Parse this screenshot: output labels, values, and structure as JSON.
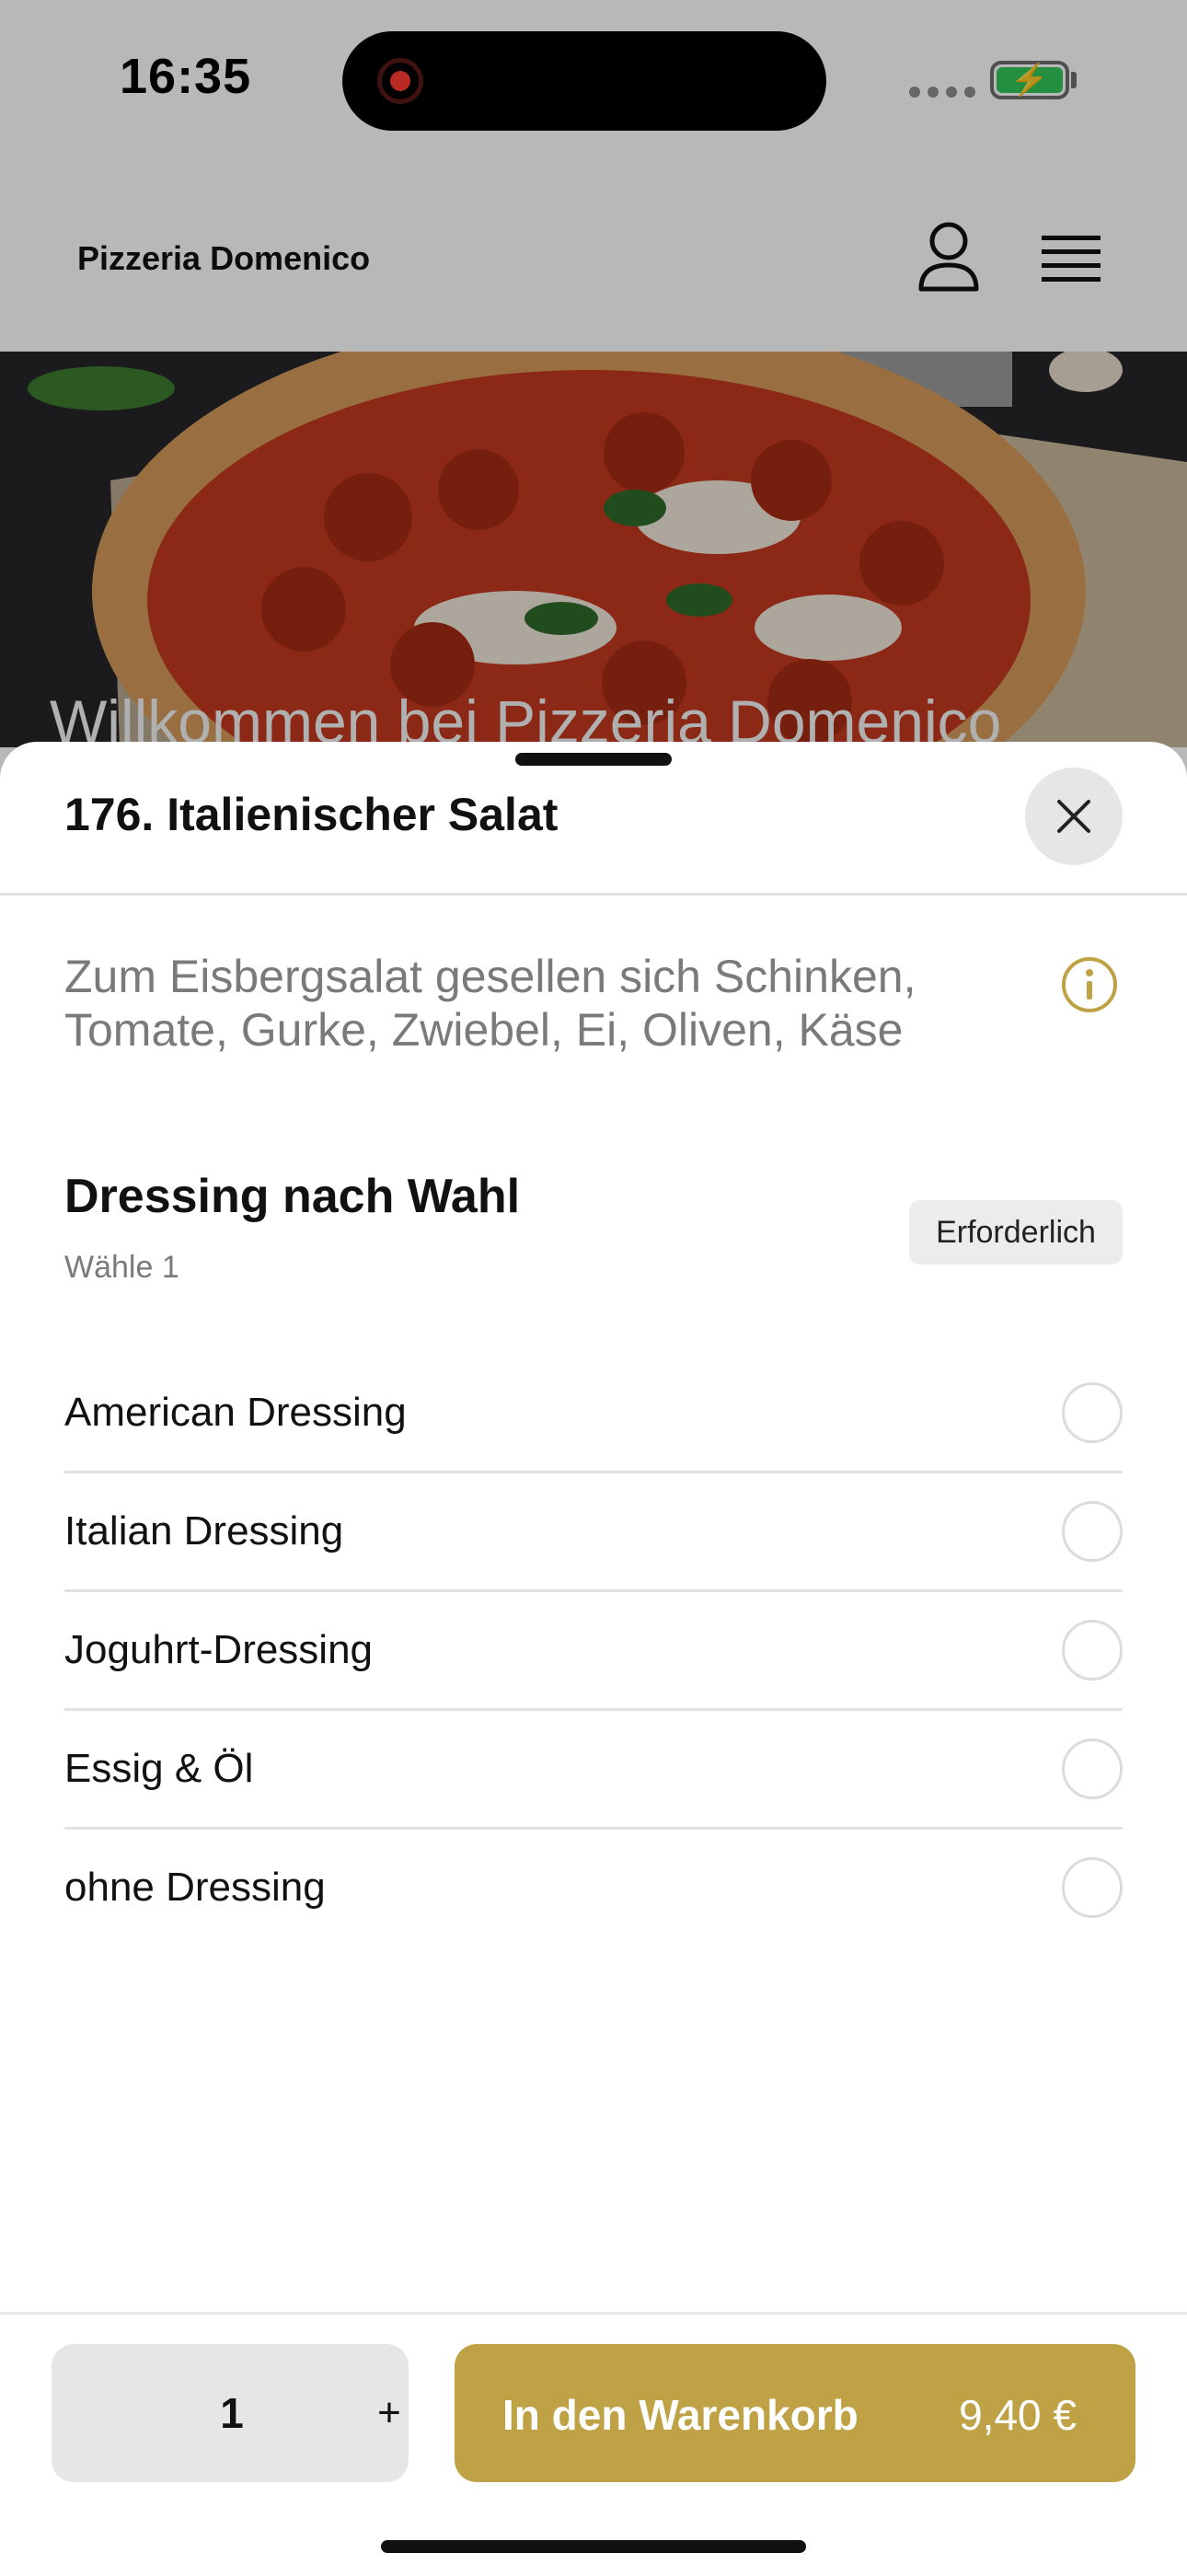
{
  "status_bar": {
    "time": "16:35"
  },
  "header": {
    "site_title": "Pizzeria Domenico"
  },
  "hero": {
    "title": "Willkommen bei Pizzeria Domenico"
  },
  "sheet": {
    "product_title": "176. Italienischer Salat",
    "description": "Zum Eisbergsalat gesellen sich Schinken, Tomate, Gurke, Zwiebel, Ei, Oliven, Käse",
    "option_group": {
      "title": "Dressing nach Wahl",
      "subtitle": "Wähle 1",
      "badge": "Erforderlich",
      "options": [
        {
          "label": "American Dressing",
          "selected": false
        },
        {
          "label": "Italian Dressing",
          "selected": false
        },
        {
          "label": "Joguhrt-Dressing",
          "selected": false
        },
        {
          "label": "Essig & Öl",
          "selected": false
        },
        {
          "label": "ohne Dressing",
          "selected": false
        }
      ]
    }
  },
  "bottom_bar": {
    "quantity": "1",
    "plus_label": "+",
    "cart_label": "In den Warenkorb",
    "price": "9,40 €"
  },
  "colors": {
    "accent": "#bfa245",
    "battery_green": "#34c759",
    "record_red": "#ff3b30"
  },
  "icons": [
    "record-icon",
    "battery-icon",
    "account-icon",
    "menu-icon",
    "close-icon",
    "info-icon"
  ]
}
